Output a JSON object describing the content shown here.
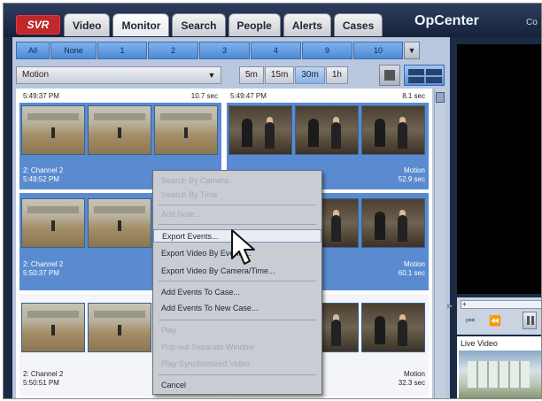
{
  "header": {
    "logo": "SVR",
    "tabs": [
      "Video",
      "Monitor",
      "Search",
      "People",
      "Alerts",
      "Cases"
    ],
    "active_tab": "Monitor",
    "brand": "OpCenter",
    "brand_extra": "Co"
  },
  "camera_tabs": [
    "All",
    "None",
    "1",
    "2",
    "3",
    "4",
    "9",
    "10"
  ],
  "filter": {
    "selected": "Motion"
  },
  "time_range": {
    "options": [
      "5m",
      "15m",
      "30m",
      "1h"
    ],
    "selected": "30m"
  },
  "events": [
    {
      "time": "5:49:37 PM",
      "duration": "10.7 sec",
      "channel": "2: Channel 2",
      "end_time": "5:49:52 PM",
      "type": "",
      "length": ""
    },
    {
      "time": "5:49:47 PM",
      "duration": "8.1 sec",
      "channel": "",
      "end_time": "",
      "type": "Motion",
      "length": "52.9 sec"
    },
    {
      "time": "",
      "duration": "",
      "channel": "2: Channel 2",
      "end_time": "5:50:37 PM",
      "type": "",
      "length": ""
    },
    {
      "time": "",
      "duration": "",
      "channel": "",
      "end_time": "",
      "type": "Motion",
      "length": "60.1 sec"
    },
    {
      "time": "",
      "duration": "",
      "channel": "2: Channel 2",
      "end_time": "5:50:51 PM",
      "type": "",
      "length": ""
    },
    {
      "time": "",
      "duration": "",
      "channel": "",
      "end_time": "",
      "type": "Motion",
      "length": "32.3 sec"
    }
  ],
  "context_menu": {
    "items": [
      {
        "label": "Search By Camera",
        "enabled": false
      },
      {
        "label": "Search By Time",
        "enabled": false
      },
      {
        "label": "Add Note...",
        "enabled": false
      },
      {
        "label": "Export Events...",
        "enabled": true
      },
      {
        "label": "Export Video By Events...",
        "enabled": true
      },
      {
        "label": "Export Video By Camera/Time...",
        "enabled": true
      },
      {
        "label": "Add Events To Case...",
        "enabled": true
      },
      {
        "label": "Add Events To New Case...",
        "enabled": true
      },
      {
        "label": "Play",
        "enabled": false
      },
      {
        "label": "Pop-out Separate Window",
        "enabled": false
      },
      {
        "label": "Play Synchronized Video",
        "enabled": false
      },
      {
        "label": "Cancel",
        "enabled": true
      }
    ],
    "highlighted": "Export Events..."
  },
  "player": {
    "rewind_icon": "rewind-icon",
    "step_back_icon": "step-back-icon",
    "pause_icon": "pause-icon",
    "live_label": "Live Video"
  },
  "colors": {
    "header_bg": "#16223a",
    "selection_blue": "#5a8bd0",
    "panel_bg": "#b9c8de"
  }
}
